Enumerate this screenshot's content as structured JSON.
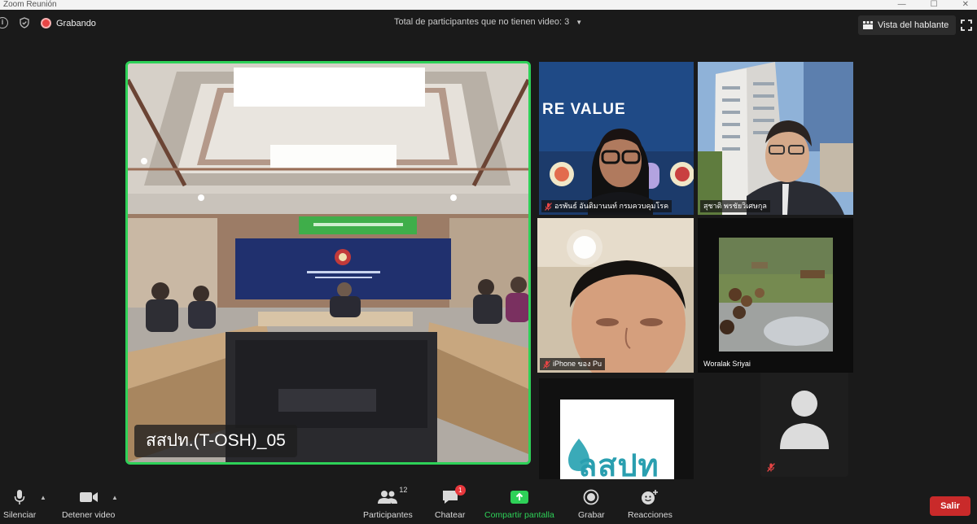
{
  "window": {
    "title": "Zoom Reunión"
  },
  "topbar": {
    "recording_label": "Grabando",
    "no_video_text": "Total de participantes que no tienen video: 3",
    "view_button_label": "Vista del hablante"
  },
  "main_video": {
    "name": "สสปท.(T-OSH)_05"
  },
  "tiles": [
    {
      "name": "อรพันธ์ อันติมานนท์ กรมควบคุมโรค",
      "muted": true,
      "background_text": "RE VALUE"
    },
    {
      "name": "สุชาติ พรชัยวิเศษกุล",
      "muted": false
    },
    {
      "name": "iPhone ของ Pu",
      "muted": true
    },
    {
      "name": "Woralak Sriyai",
      "muted": false
    },
    {
      "name": "",
      "logo_text": "ลสปท"
    },
    {
      "name": "",
      "muted": true,
      "avatar": "person-icon"
    }
  ],
  "toolbar": {
    "mute_label": "Silenciar",
    "video_label": "Detener video",
    "participants_label": "Participantes",
    "participants_count": "12",
    "chat_label": "Chatear",
    "chat_badge": "1",
    "share_label": "Compartir pantalla",
    "record_label": "Grabar",
    "reactions_label": "Reacciones",
    "exit_label": "Salir"
  },
  "colors": {
    "active_speaker_border": "#2ed158",
    "recording_dot": "#e84545",
    "exit_button": "#c92a2a",
    "share_green": "#2ed158"
  }
}
